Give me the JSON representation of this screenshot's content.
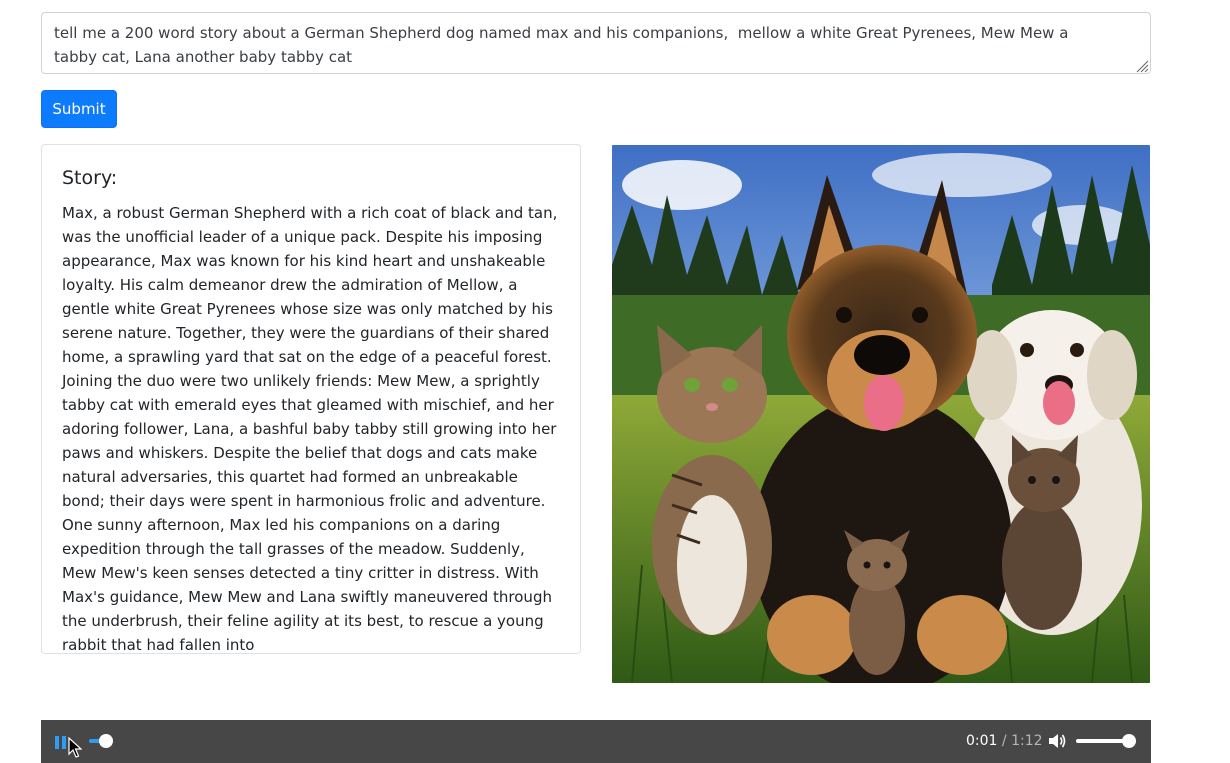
{
  "prompt": {
    "value": "tell me a 200 word story about a German Shepherd dog named max and his companions,  mellow a white Great Pyrenees, Mew Mew a tabby cat, Lana another baby tabby cat"
  },
  "submit_label": "Submit",
  "story": {
    "title": "Story:",
    "text": "Max, a robust German Shepherd with a rich coat of black and tan, was the unofficial leader of a unique pack. Despite his imposing appearance, Max was known for his kind heart and unshakeable loyalty. His calm demeanor drew the admiration of Mellow, a gentle white Great Pyrenees whose size was only matched by his serene nature. Together, they were the guardians of their shared home, a sprawling yard that sat on the edge of a peaceful forest. Joining the duo were two unlikely friends: Mew Mew, a sprightly tabby cat with emerald eyes that gleamed with mischief, and her adoring follower, Lana, a bashful baby tabby still growing into her paws and whiskers. Despite the belief that dogs and cats make natural adversaries, this quartet had formed an unbreakable bond; their days were spent in harmonious frolic and adventure. One sunny afternoon, Max led his companions on a daring expedition through the tall grasses of the meadow. Suddenly, Mew Mew's keen senses detected a tiny critter in distress. With Max's guidance, Mew Mew and Lana swiftly maneuvered through the underbrush, their feline agility at its best, to rescue a young rabbit that had fallen into"
  },
  "audio": {
    "current_time": "0:01",
    "separator": " / ",
    "total_time": "1:12",
    "progress_fraction": 0.014,
    "volume_fraction": 0.9,
    "state": "playing"
  },
  "icons": {
    "play_pause": "pause-icon",
    "volume": "volume-icon",
    "cursor": "mouse-pointer-icon",
    "resize": "resize-grip-icon"
  },
  "colors": {
    "primary_button": "#0d7bfd",
    "audio_bar": "#474747",
    "audio_accent": "#2d9cf4"
  }
}
